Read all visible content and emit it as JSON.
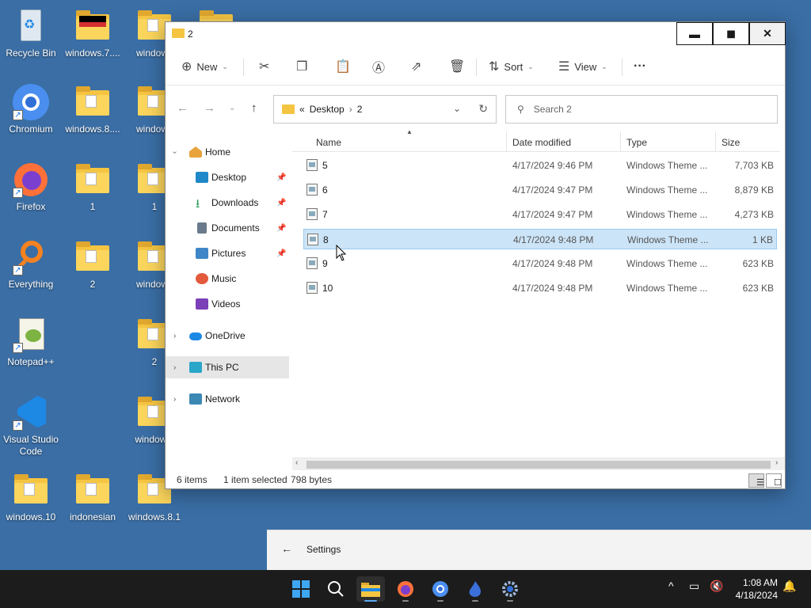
{
  "desktop": {
    "icons": [
      {
        "label": "Recycle Bin"
      },
      {
        "label": "windows.7...."
      },
      {
        "label": "windows"
      },
      {
        "label": "Chromium"
      },
      {
        "label": "windows.8...."
      },
      {
        "label": "windows"
      },
      {
        "label": "Firefox"
      },
      {
        "label": "1"
      },
      {
        "label": "1"
      },
      {
        "label": "Everything"
      },
      {
        "label": "2"
      },
      {
        "label": "windows"
      },
      {
        "label": "Notepad++"
      },
      {
        "label": "2"
      },
      {
        "label": "Visual Studio Code"
      },
      {
        "label": "windows."
      },
      {
        "label": "windows.10"
      },
      {
        "label": "indonesian"
      },
      {
        "label": "windows.8.1"
      }
    ]
  },
  "explorer": {
    "title": "2",
    "toolbar": {
      "new_label": "New",
      "sort_label": "Sort",
      "view_label": "View",
      "more_label": "···"
    },
    "address": {
      "prefix": "«",
      "crumbs": [
        "Desktop",
        "2"
      ]
    },
    "search": {
      "placeholder": "Search 2"
    },
    "nav": {
      "home": "Home",
      "quick_access": [
        {
          "label": "Desktop",
          "pinned": true
        },
        {
          "label": "Downloads",
          "pinned": true
        },
        {
          "label": "Documents",
          "pinned": true
        },
        {
          "label": "Pictures",
          "pinned": true
        },
        {
          "label": "Music",
          "pinned": false
        },
        {
          "label": "Videos",
          "pinned": false
        }
      ],
      "onedrive": "OneDrive",
      "this_pc": "This PC",
      "network": "Network"
    },
    "columns": [
      "Name",
      "Date modified",
      "Type",
      "Size"
    ],
    "files": [
      {
        "name": "5",
        "date": "4/17/2024 9:46 PM",
        "type": "Windows Theme ...",
        "size": "7,703 KB"
      },
      {
        "name": "6",
        "date": "4/17/2024 9:47 PM",
        "type": "Windows Theme ...",
        "size": "8,879 KB"
      },
      {
        "name": "7",
        "date": "4/17/2024 9:47 PM",
        "type": "Windows Theme ...",
        "size": "4,273 KB"
      },
      {
        "name": "8",
        "date": "4/17/2024 9:48 PM",
        "type": "Windows Theme ...",
        "size": "1 KB"
      },
      {
        "name": "9",
        "date": "4/17/2024 9:48 PM",
        "type": "Windows Theme ...",
        "size": "623 KB"
      },
      {
        "name": "10",
        "date": "4/17/2024 9:48 PM",
        "type": "Windows Theme ...",
        "size": "623 KB"
      }
    ],
    "selected_index": 3,
    "status": {
      "items": "6 items",
      "selected": "1 item selected",
      "size": "798 bytes"
    }
  },
  "settings_window": {
    "back_label": "←",
    "title": "Settings"
  },
  "taskbar": {
    "clock_time": "1:08 AM",
    "clock_date": "4/18/2024"
  }
}
